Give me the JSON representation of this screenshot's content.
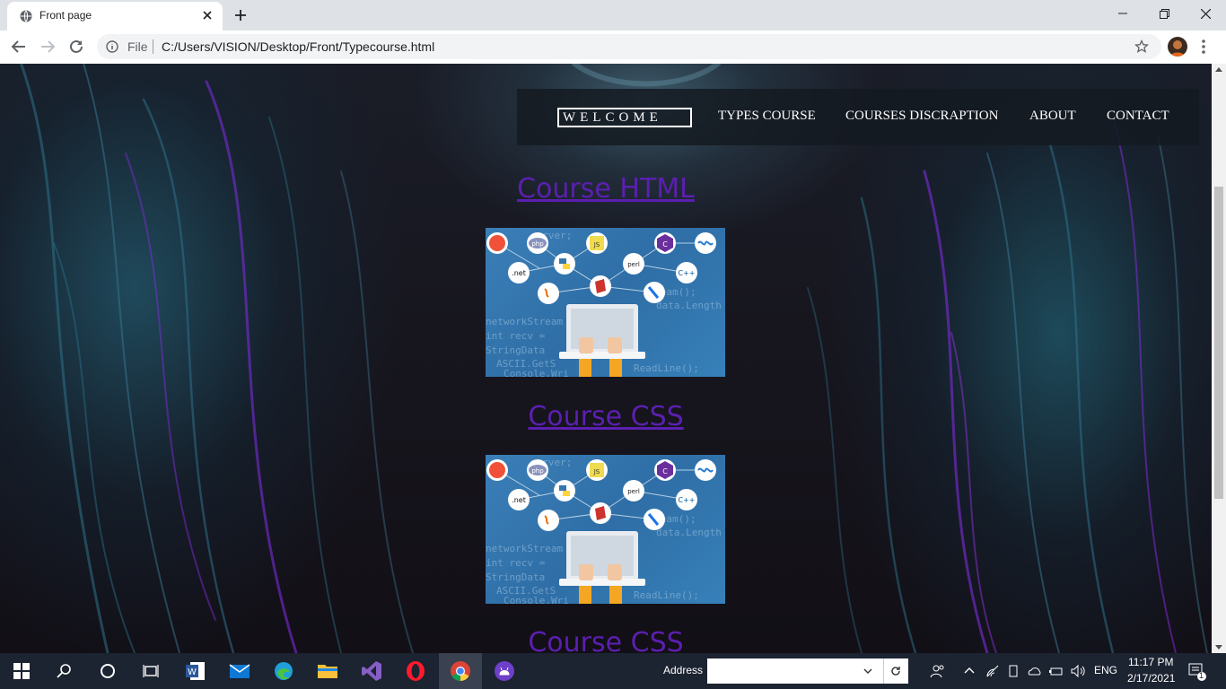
{
  "browser": {
    "tab_title": "Front page",
    "file_label": "File",
    "url": "C:/Users/VISION/Desktop/Front/Typecourse.html"
  },
  "site": {
    "nav": {
      "welcome": "WELCOME",
      "types_course": "TYPES COURSE",
      "courses_discraption": "COURSES DISCRAPTION",
      "about": "ABOUT",
      "contact": "CONTACT"
    },
    "courses": [
      {
        "title": "Course HTML"
      },
      {
        "title": "Course CSS"
      },
      {
        "title": "Course CSS"
      }
    ],
    "image_badges": {
      "php": "php",
      "net": ".net",
      "cpp": "C++",
      "perl": "perl",
      "js": "JS",
      "csharp": "C"
    },
    "image_code_lines": [
      "server;",
      "networkStream",
      "int recv =",
      "StringData",
      "ASCII.GetS",
      "Console.Wri",
      "ReadLine();",
      "Stream();",
      "data.Length"
    ]
  },
  "taskbar": {
    "address_label": "Address",
    "language": "ENG",
    "time": "11:17 PM",
    "date": "2/17/2021",
    "notification_count": "1"
  },
  "colors": {
    "course_title": "#5b1fb0",
    "nav_bg": "#141a21",
    "taskbar_bg": "#1c2331"
  }
}
